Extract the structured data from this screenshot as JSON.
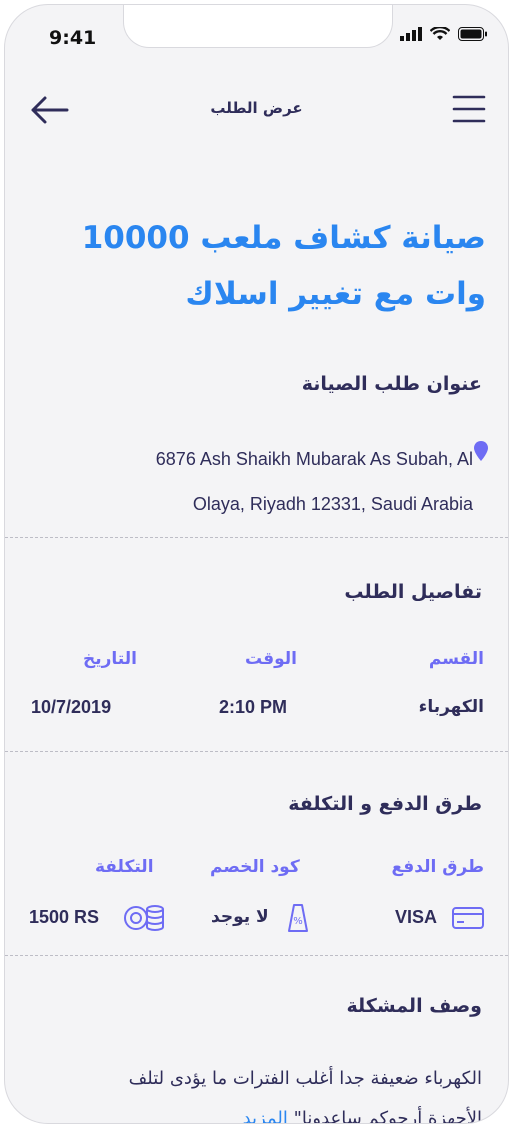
{
  "status": {
    "time": "9:41"
  },
  "header": {
    "title": "عرض الطلب"
  },
  "request": {
    "title": "صيانة كشاف ملعب 10000 وات مع تغيير اسلاك"
  },
  "address_section": {
    "title": "عنوان طلب الصيانة",
    "line1": "6876 Ash Shaikh Mubarak As Subah, Al",
    "line2": "Olaya, Riyadh 12331, Saudi Arabia"
  },
  "details_section": {
    "title": "تفاصيل الطلب",
    "category_label": "القسم",
    "category_value": "الكهرباء",
    "time_label": "الوقت",
    "time_value": "2:10 PM",
    "date_label": "التاريخ",
    "date_value": "10/7/2019"
  },
  "payment_section": {
    "title": "طرق الدفع و التكلفة",
    "method_label": "طرق الدفع",
    "method_value": "VISA",
    "discount_label": "كود الخصم",
    "discount_value": "لا يوجد",
    "cost_label": "التكلفة",
    "cost_value": "1500 RS"
  },
  "problem_section": {
    "title": "وصف المشكلة",
    "text_line1": "الكهرباء ضعيفة جدا أغلب الفترات ما يؤدى لتلف",
    "text_line2": "الأجهزة أرجوكم ساعدونا\"",
    "more_link": "المزيد"
  },
  "colors": {
    "accent": "#2a86f0",
    "label": "#6e6cf4",
    "text": "#2f2d5a",
    "background": "#f4f4f6"
  }
}
